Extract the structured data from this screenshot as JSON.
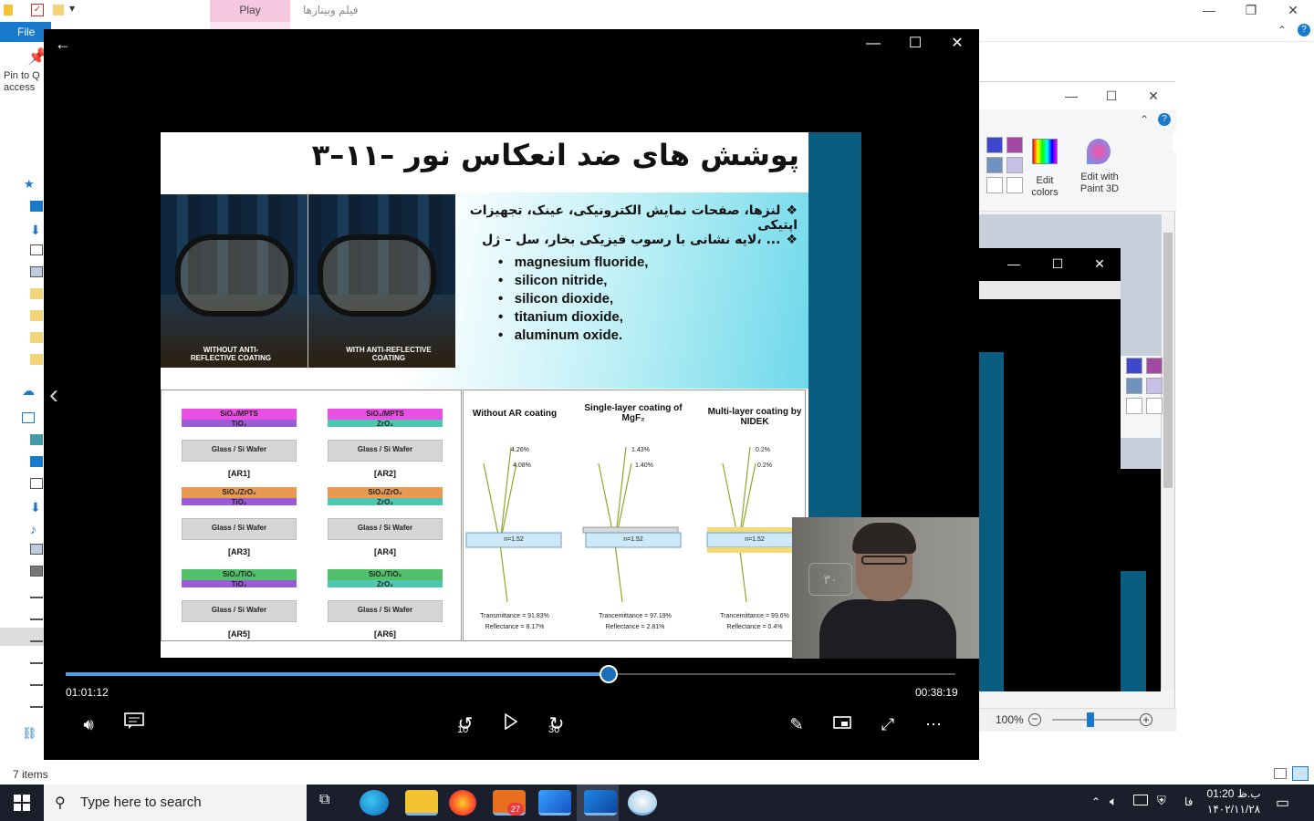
{
  "explorer": {
    "title": "فیلم وبینارها",
    "file_tab": "File",
    "play_tab": "Play",
    "pin_label": "Pin to Q access",
    "status_items": "7 items"
  },
  "paint": {
    "edit_colors": "Edit colors",
    "edit_paint3d": "Edit with Paint 3D",
    "zoom": "100%",
    "colors": {
      "blue": "#3f48cc",
      "purple": "#a349a4",
      "steelblue": "#7092be",
      "lavender": "#c8bfe7"
    }
  },
  "player": {
    "time_elapsed": "01:01:12",
    "time_remaining": "00:38:19",
    "progress_fraction": 0.61,
    "skip_back": "10",
    "skip_forward": "30",
    "accent": "#4aa0e6"
  },
  "slide": {
    "title": "۳–۱۱– پوشش های ضد انعکاس نور",
    "bullet1": "لنزها، صفحات نمایش الکترونیکی، عینک، تجهیزات اپتیکی",
    "bullet2": "لایه نشانی با رسوب فیزیکی بخار، سل – ژل، ...",
    "materials": [
      "magnesium  fluoride,",
      "silicon nitride,",
      "silicon dioxide,",
      "titanium dioxide,",
      "aluminum oxide."
    ],
    "photo_without": "WITHOUT ANTI-REFLECTIVE COATING",
    "photo_with": "WITH ANTI-REFLECTIVE COATING",
    "ar_items": [
      {
        "top": "SiO₂/MPTS",
        "mid": "TiO₂",
        "base": "Glass / Si Wafer",
        "label": "[AR1]"
      },
      {
        "top": "SiO₂/MPTS",
        "mid": "ZrO₂",
        "base": "Glass / Si Wafer",
        "label": "[AR2]"
      },
      {
        "top": "SiO₂/ZrO₂",
        "mid": "TiO₂",
        "base": "Glass / Si Wafer",
        "label": "[AR3]"
      },
      {
        "top": "SiO₂/ZrO₂",
        "mid": "ZrO₂",
        "base": "Glass / Si Wafer",
        "label": "[AR4]"
      },
      {
        "top": "SiO₂/TiO₂",
        "mid": "TiO₂",
        "base": "Glass / Si Wafer",
        "label": "[AR5]"
      },
      {
        "top": "SiO₂/TiO₂",
        "mid": "ZrO₂",
        "base": "Glass / Si Wafer",
        "label": "[AR6]"
      }
    ],
    "coatings": [
      {
        "head": "Without AR coating",
        "r1": "4.26%",
        "r2": "4.08%",
        "n": "n=1.52",
        "t": "Transmittance = 91.83%",
        "r": "Reflectance = 8.17%"
      },
      {
        "head": "Single-layer coating of MgF₂",
        "r1": "1.43%",
        "r2": "1.40%",
        "n": "n=1.52",
        "t": "Trancemittance = 97.19%",
        "r": "Reflectance = 2.81%"
      },
      {
        "head": "Multi-layer coating by NIDEK",
        "r1": "0.2%",
        "r2": "0.2%",
        "n": "n=1.52",
        "t": "Trancemittance = 99.6%",
        "r": "Reflectance = 0.4%"
      }
    ]
  },
  "webcam": {
    "sign": "۳۰"
  },
  "taskbar": {
    "search_placeholder": "Type here to search",
    "badge": "27",
    "lang": "فا",
    "time": "01:20 ب.ظ",
    "date": "۱۴۰۲/۱۱/۲۸"
  }
}
